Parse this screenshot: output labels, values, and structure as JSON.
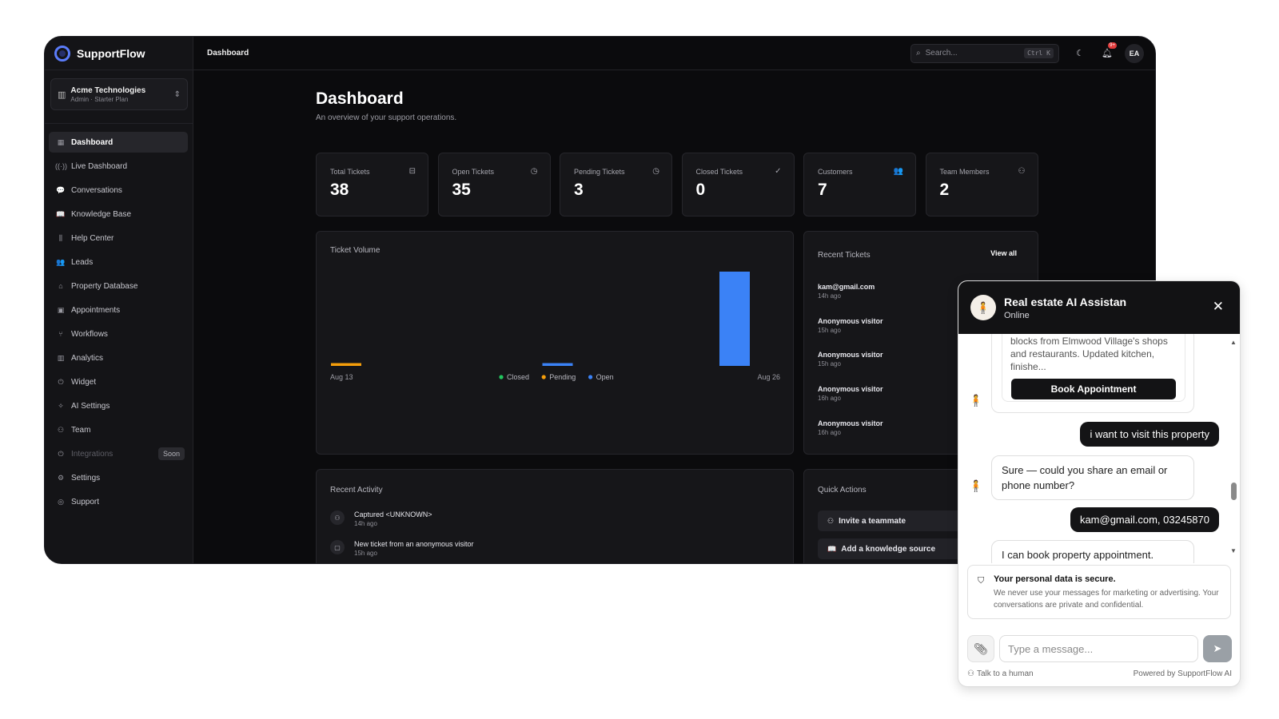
{
  "app": {
    "brand": "SupportFlow",
    "org_name": "Acme Technologies",
    "org_plan": "Admin · Starter Plan"
  },
  "sidebar": {
    "items": [
      {
        "label": "Dashboard",
        "icon": "grid-icon",
        "glyph": "▦"
      },
      {
        "label": "Live Dashboard",
        "icon": "radio-icon",
        "glyph": "((·))"
      },
      {
        "label": "Conversations",
        "icon": "chat-icon",
        "glyph": "💬"
      },
      {
        "label": "Knowledge Base",
        "icon": "book-icon",
        "glyph": "📖"
      },
      {
        "label": "Help Center",
        "icon": "library-icon",
        "glyph": "⫼"
      },
      {
        "label": "Leads",
        "icon": "users-icon",
        "glyph": "👥"
      },
      {
        "label": "Property Database",
        "icon": "home-icon",
        "glyph": "⌂"
      },
      {
        "label": "Appointments",
        "icon": "calendar-icon",
        "glyph": "▣"
      },
      {
        "label": "Workflows",
        "icon": "workflow-icon",
        "glyph": "⑂"
      },
      {
        "label": "Analytics",
        "icon": "chart-icon",
        "glyph": "▥"
      },
      {
        "label": "Widget",
        "icon": "plug-icon",
        "glyph": "⏻"
      },
      {
        "label": "AI Settings",
        "icon": "sparkle-icon",
        "glyph": "✧"
      },
      {
        "label": "Team",
        "icon": "user-icon",
        "glyph": "⚇"
      },
      {
        "label": "Integrations",
        "icon": "plug-icon",
        "glyph": "⏻",
        "badge": "Soon"
      },
      {
        "label": "Settings",
        "icon": "gear-icon",
        "glyph": "⚙"
      },
      {
        "label": "Support",
        "icon": "lifebuoy-icon",
        "glyph": "◎"
      }
    ]
  },
  "topbar": {
    "breadcrumb": "Dashboard",
    "search_placeholder": "Search...",
    "search_shortcut": "Ctrl K",
    "notification_count": "9+",
    "avatar_initials": "EA"
  },
  "page": {
    "title": "Dashboard",
    "subtitle": "An overview of your support operations."
  },
  "stats": [
    {
      "label": "Total Tickets",
      "value": "38",
      "icon": "inbox-icon",
      "glyph": "⊟"
    },
    {
      "label": "Open Tickets",
      "value": "35",
      "icon": "clock-icon",
      "glyph": "◷"
    },
    {
      "label": "Pending Tickets",
      "value": "3",
      "icon": "clock-icon",
      "glyph": "◷"
    },
    {
      "label": "Closed Tickets",
      "value": "0",
      "icon": "check-circle-icon",
      "glyph": "✓"
    },
    {
      "label": "Customers",
      "value": "7",
      "icon": "users-icon",
      "glyph": "👥"
    },
    {
      "label": "Team Members",
      "value": "2",
      "icon": "user-plus-icon",
      "glyph": "⚇"
    }
  ],
  "ticket_volume": {
    "title": "Ticket Volume"
  },
  "chart_data": {
    "type": "bar",
    "title": "Ticket Volume",
    "x_start_label": "Aug 13",
    "x_end_label": "Aug 26",
    "series": [
      {
        "name": "Closed",
        "color": "#22c55e",
        "values": [
          0,
          0,
          0
        ]
      },
      {
        "name": "Pending",
        "color": "#f59e0b",
        "values": [
          1,
          0,
          0
        ]
      },
      {
        "name": "Open",
        "color": "#3b82f6",
        "values": [
          0,
          1,
          34
        ]
      }
    ],
    "groups": 3,
    "legend": "bottom-center",
    "grid": false
  },
  "recent_tickets": {
    "title": "Recent Tickets",
    "view_all": "View all",
    "items": [
      {
        "name": "kam@gmail.com",
        "time": "14h ago"
      },
      {
        "name": "Anonymous visitor",
        "time": "15h ago"
      },
      {
        "name": "Anonymous visitor",
        "time": "15h ago"
      },
      {
        "name": "Anonymous visitor",
        "time": "16h ago"
      },
      {
        "name": "Anonymous visitor",
        "time": "16h ago"
      }
    ]
  },
  "recent_activity": {
    "title": "Recent Activity",
    "items": [
      {
        "title": "Captured <UNKNOWN>",
        "time": "14h ago",
        "icon": "user-icon",
        "glyph": "⚇"
      },
      {
        "title": "New ticket from an anonymous visitor",
        "time": "15h ago",
        "icon": "message-icon",
        "glyph": "▢"
      }
    ]
  },
  "quick_actions": {
    "title": "Quick Actions",
    "items": [
      {
        "label": "Invite a teammate",
        "icon": "user-plus-icon",
        "glyph": "⚇"
      },
      {
        "label": "Add a knowledge source",
        "icon": "book-icon",
        "glyph": "📖"
      }
    ]
  },
  "chat": {
    "title": "Real estate AI Assistan",
    "status": "Online",
    "property_text": "blocks from Elmwood Village's shops and restaurants. Updated kitchen, finishe...",
    "book_button": "Book Appointment",
    "messages": [
      {
        "from": "user",
        "text": "i want to visit this property"
      },
      {
        "from": "bot",
        "text": "Sure — could you share an email or phone number?"
      },
      {
        "from": "user",
        "text": "kam@gmail.com, 03245870"
      },
      {
        "from": "bot",
        "text": "I can book property appointment."
      }
    ],
    "secure_title": "Your personal data is secure.",
    "secure_text": "We never use your messages for marketing or advertising. Your conversations are private and confidential.",
    "input_placeholder": "Type a message...",
    "talk_human": "Talk to a human",
    "powered_by": "Powered by SupportFlow AI"
  }
}
